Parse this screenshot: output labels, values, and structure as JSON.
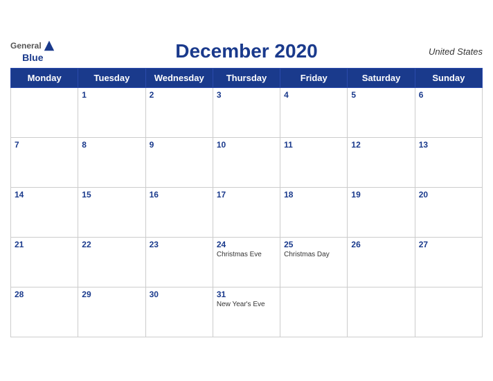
{
  "header": {
    "logo": {
      "general": "General",
      "blue": "Blue"
    },
    "title": "December 2020",
    "country": "United States"
  },
  "weekdays": [
    "Monday",
    "Tuesday",
    "Wednesday",
    "Thursday",
    "Friday",
    "Saturday",
    "Sunday"
  ],
  "weeks": [
    [
      {
        "day": "",
        "holiday": ""
      },
      {
        "day": "1",
        "holiday": ""
      },
      {
        "day": "2",
        "holiday": ""
      },
      {
        "day": "3",
        "holiday": ""
      },
      {
        "day": "4",
        "holiday": ""
      },
      {
        "day": "5",
        "holiday": ""
      },
      {
        "day": "6",
        "holiday": ""
      }
    ],
    [
      {
        "day": "7",
        "holiday": ""
      },
      {
        "day": "8",
        "holiday": ""
      },
      {
        "day": "9",
        "holiday": ""
      },
      {
        "day": "10",
        "holiday": ""
      },
      {
        "day": "11",
        "holiday": ""
      },
      {
        "day": "12",
        "holiday": ""
      },
      {
        "day": "13",
        "holiday": ""
      }
    ],
    [
      {
        "day": "14",
        "holiday": ""
      },
      {
        "day": "15",
        "holiday": ""
      },
      {
        "day": "16",
        "holiday": ""
      },
      {
        "day": "17",
        "holiday": ""
      },
      {
        "day": "18",
        "holiday": ""
      },
      {
        "day": "19",
        "holiday": ""
      },
      {
        "day": "20",
        "holiday": ""
      }
    ],
    [
      {
        "day": "21",
        "holiday": ""
      },
      {
        "day": "22",
        "holiday": ""
      },
      {
        "day": "23",
        "holiday": ""
      },
      {
        "day": "24",
        "holiday": "Christmas Eve"
      },
      {
        "day": "25",
        "holiday": "Christmas Day"
      },
      {
        "day": "26",
        "holiday": ""
      },
      {
        "day": "27",
        "holiday": ""
      }
    ],
    [
      {
        "day": "28",
        "holiday": ""
      },
      {
        "day": "29",
        "holiday": ""
      },
      {
        "day": "30",
        "holiday": ""
      },
      {
        "day": "31",
        "holiday": "New Year's Eve"
      },
      {
        "day": "",
        "holiday": ""
      },
      {
        "day": "",
        "holiday": ""
      },
      {
        "day": "",
        "holiday": ""
      }
    ]
  ]
}
